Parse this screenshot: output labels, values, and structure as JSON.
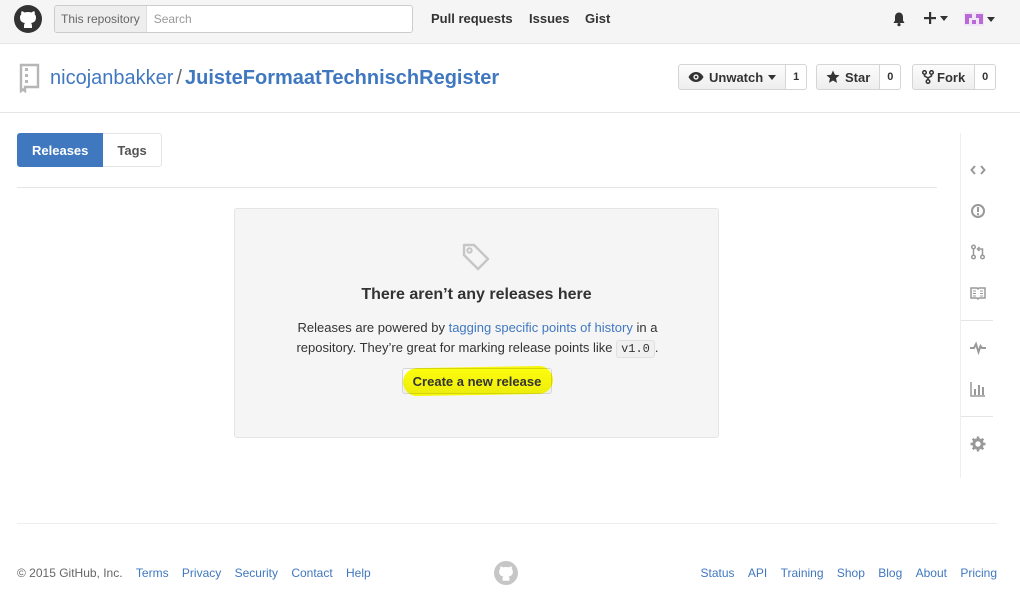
{
  "header": {
    "search_scope": "This repository",
    "search_placeholder": "Search",
    "nav": [
      "Pull requests",
      "Issues",
      "Gist"
    ],
    "icons": [
      "github-logo-icon",
      "bell-icon",
      "plus-icon",
      "avatar-icon"
    ]
  },
  "repo": {
    "owner": "nicojanbakker",
    "separator": "/",
    "name": "JuisteFormaatTechnischRegister",
    "watch_label": "Unwatch",
    "watch_count": "1",
    "star_label": "Star",
    "star_count": "0",
    "fork_label": "Fork",
    "fork_count": "0"
  },
  "subnav": {
    "releases": "Releases",
    "tags": "Tags",
    "selected": "Releases"
  },
  "blankslate": {
    "title": "There aren’t any releases here",
    "text_before": "Releases are powered by ",
    "link": "tagging specific points of history",
    "text_mid": " in a repository. They’re great for marking release points like ",
    "code": "v1.0",
    "text_after": ".",
    "button": "Create a new release",
    "highlight_color": "#ffff00"
  },
  "rail_icons": [
    "code-icon",
    "issue-icon",
    "pull-request-icon",
    "wiki-icon",
    "pulse-icon",
    "graph-icon",
    "settings-icon"
  ],
  "footer": {
    "copyright": "© 2015 GitHub, Inc.",
    "left_links": [
      "Terms",
      "Privacy",
      "Security",
      "Contact",
      "Help"
    ],
    "right_links": [
      "Status",
      "API",
      "Training",
      "Shop",
      "Blog",
      "About",
      "Pricing"
    ]
  },
  "colors": {
    "link": "#4078c0",
    "selected_tab": "#4078c0",
    "header_bg": "#f5f5f5"
  }
}
